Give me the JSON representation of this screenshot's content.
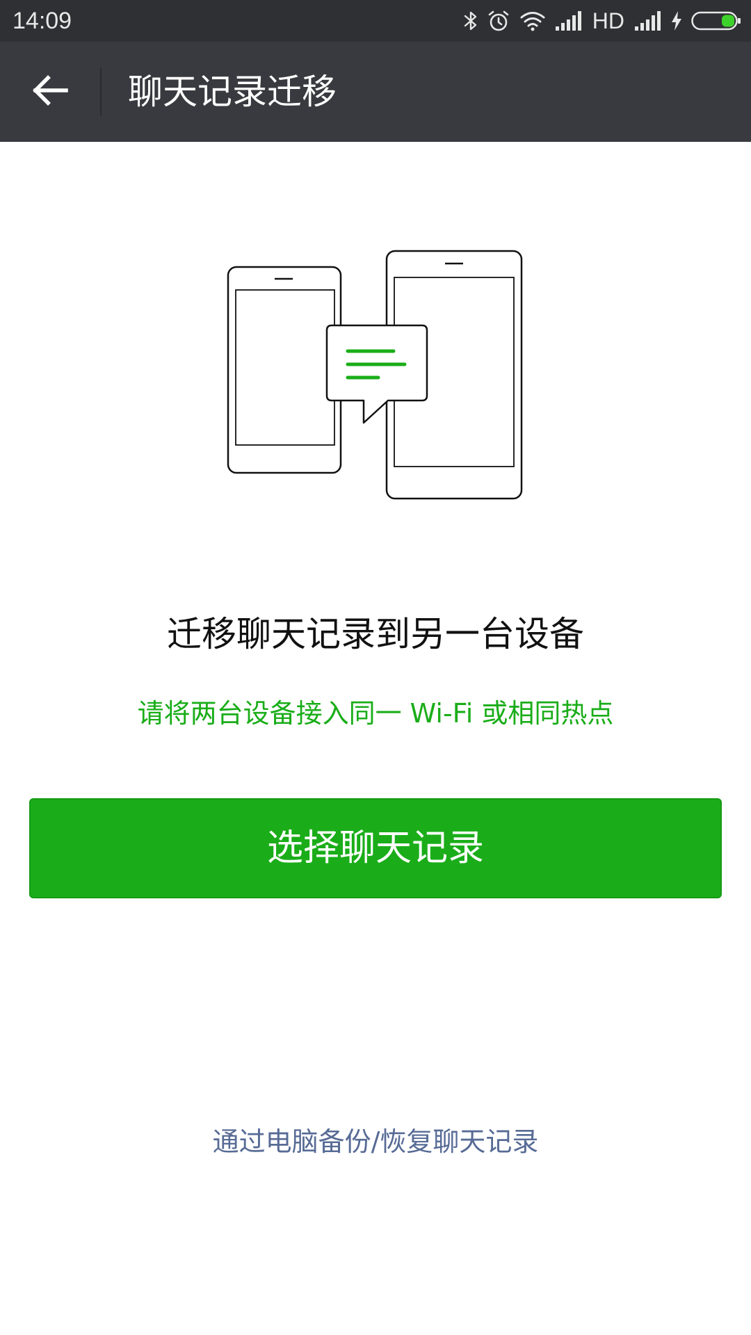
{
  "status_bar": {
    "time": "14:09",
    "network_label": "HD",
    "icons": [
      "bluetooth-icon",
      "alarm-icon",
      "wifi-icon",
      "signal-icon",
      "charging-icon",
      "battery-icon"
    ]
  },
  "app_bar": {
    "title": "聊天记录迁移",
    "back_icon": "back-arrow-icon"
  },
  "content": {
    "title": "迁移聊天记录到另一台设备",
    "hint": "请将两台设备接入同一 Wi-Fi 或相同热点",
    "primary_button_label": "选择聊天记录",
    "pc_backup_link": "通过电脑备份/恢复聊天记录"
  },
  "colors": {
    "status_bar_bg": "#2f3033",
    "app_bar_bg": "#393a3f",
    "accent_green": "#1aad19",
    "link_blue": "#576b95",
    "title_text": "#111111"
  }
}
